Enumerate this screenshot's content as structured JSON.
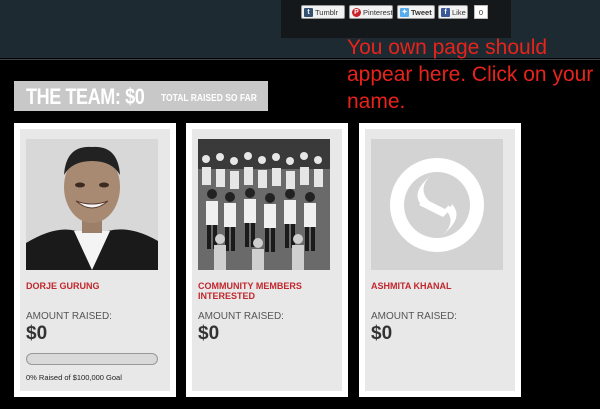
{
  "share_bar": {
    "tumblr_label": "Tumblr",
    "pinterest_label": "Pinterest",
    "tweet_label": "Tweet",
    "like_label": "Like",
    "like_count": "0",
    "icons": {
      "tumblr": "tumblr-icon",
      "pinterest": "pinterest-icon",
      "twitter": "twitter-bird-icon",
      "facebook": "facebook-icon"
    }
  },
  "overlay_note": "You own page should appear here. Click on your name.",
  "team": {
    "title": "THE TEAM: $0",
    "subtitle": "TOTAL RAISED SO FAR"
  },
  "members": [
    {
      "name": "DORJE GURUNG",
      "amount_label": "AMOUNT RAISED:",
      "amount": "$0",
      "progress_percent": 0,
      "goal_text": "0% Raised of $100,000 Goal",
      "photo": "portrait-photo"
    },
    {
      "name": "COMMUNITY MEMBERS INTERESTED",
      "amount_label": "AMOUNT RAISED:",
      "amount": "$0",
      "photo": "crowd-photo"
    },
    {
      "name": "ASHMITA KHANAL",
      "amount_label": "AMOUNT RAISED:",
      "amount": "$0",
      "photo": "placeholder-logo"
    }
  ],
  "colors": {
    "accent_red": "#c1272d",
    "note_red": "#e8231b",
    "header_bg": "#1d2a31",
    "page_bg": "#000000"
  }
}
